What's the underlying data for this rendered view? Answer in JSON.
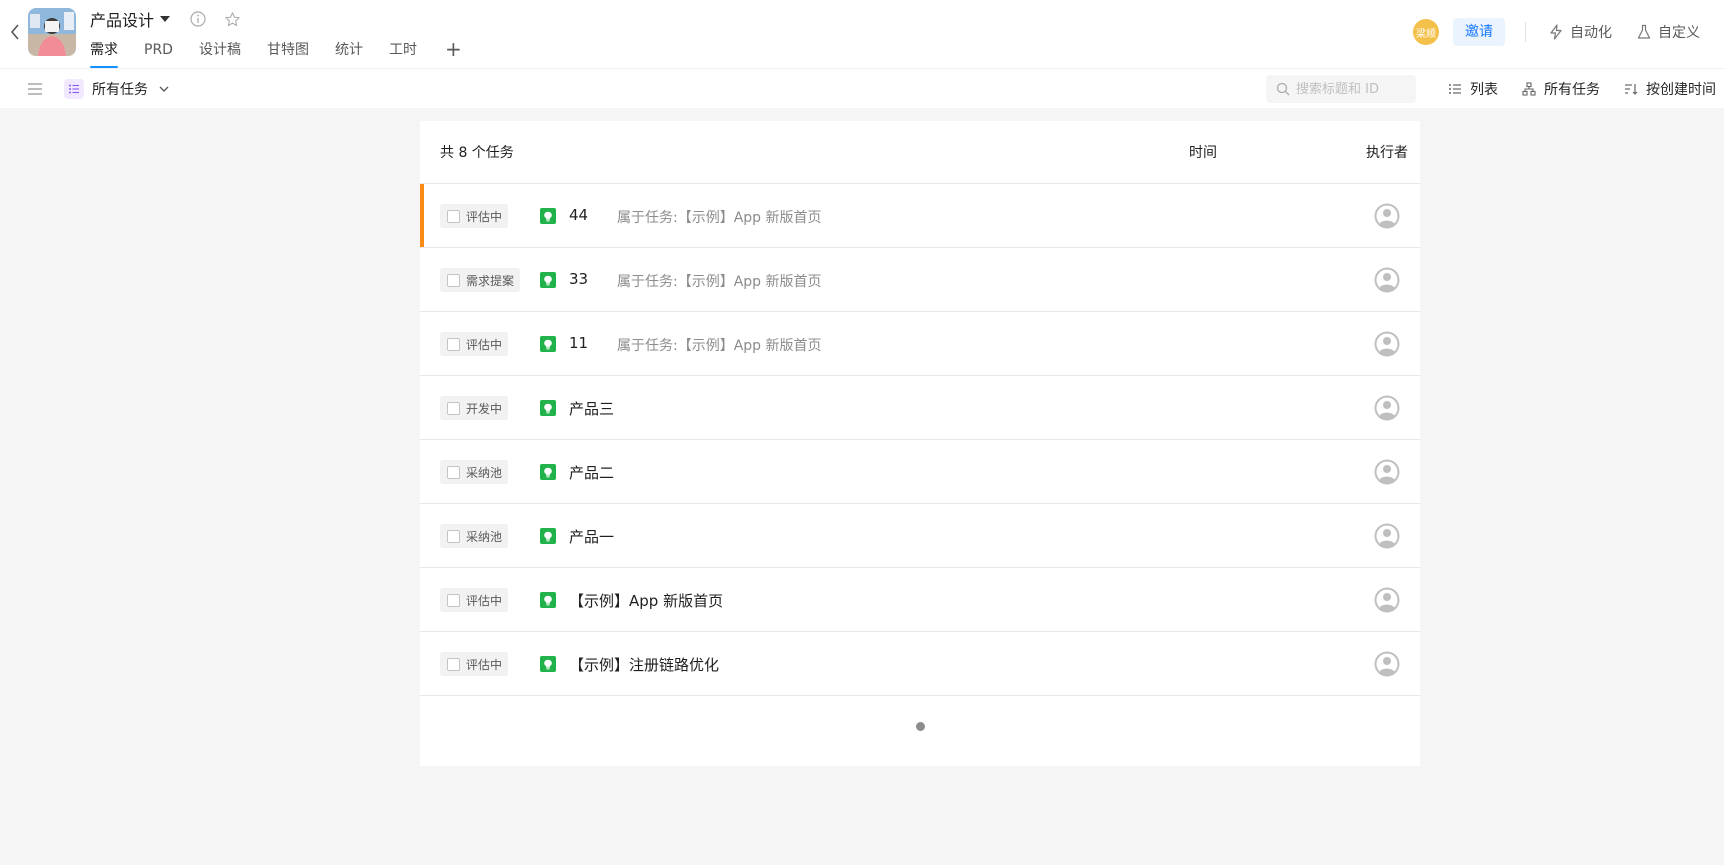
{
  "header": {
    "project_title": "产品设计",
    "tabs": [
      {
        "label": "需求",
        "active": true
      },
      {
        "label": "PRD",
        "active": false
      },
      {
        "label": "设计稿",
        "active": false
      },
      {
        "label": "甘特图",
        "active": false
      },
      {
        "label": "统计",
        "active": false
      },
      {
        "label": "工时",
        "active": false
      }
    ],
    "add_tab_label": "+",
    "user_avatar_text": "梁顺",
    "invite_label": "邀请",
    "automation_label": "自动化",
    "customize_label": "自定义"
  },
  "toolbar": {
    "view_label": "所有任务",
    "search_placeholder": "搜索标题和 ID",
    "list_label": "列表",
    "filter_label": "所有任务",
    "sort_label": "按创建时间"
  },
  "panel": {
    "count_label": "共 8 个任务",
    "time_column": "时间",
    "assignee_column": "执行者",
    "tasks": [
      {
        "status": "评估中",
        "title": "44",
        "parent": "属于任务:【示例】App 新版首页",
        "highlight": true
      },
      {
        "status": "需求提案",
        "title": "33",
        "parent": "属于任务:【示例】App 新版首页",
        "highlight": false
      },
      {
        "status": "评估中",
        "title": "11",
        "parent": "属于任务:【示例】App 新版首页",
        "highlight": false
      },
      {
        "status": "开发中",
        "title": "产品三",
        "parent": "",
        "highlight": false
      },
      {
        "status": "采纳池",
        "title": "产品二",
        "parent": "",
        "highlight": false
      },
      {
        "status": "采纳池",
        "title": "产品一",
        "parent": "",
        "highlight": false
      },
      {
        "status": "评估中",
        "title": "【示例】App 新版首页",
        "parent": "",
        "highlight": false
      },
      {
        "status": "评估中",
        "title": "【示例】注册链路优化",
        "parent": "",
        "highlight": false
      }
    ]
  },
  "colors": {
    "accent": "#1890ff",
    "highlight_bar": "#fa8c16",
    "requirement_icon": "#21b24b",
    "invite_bg": "#eaf4ff",
    "user_avatar_bg": "#f3c04a"
  }
}
